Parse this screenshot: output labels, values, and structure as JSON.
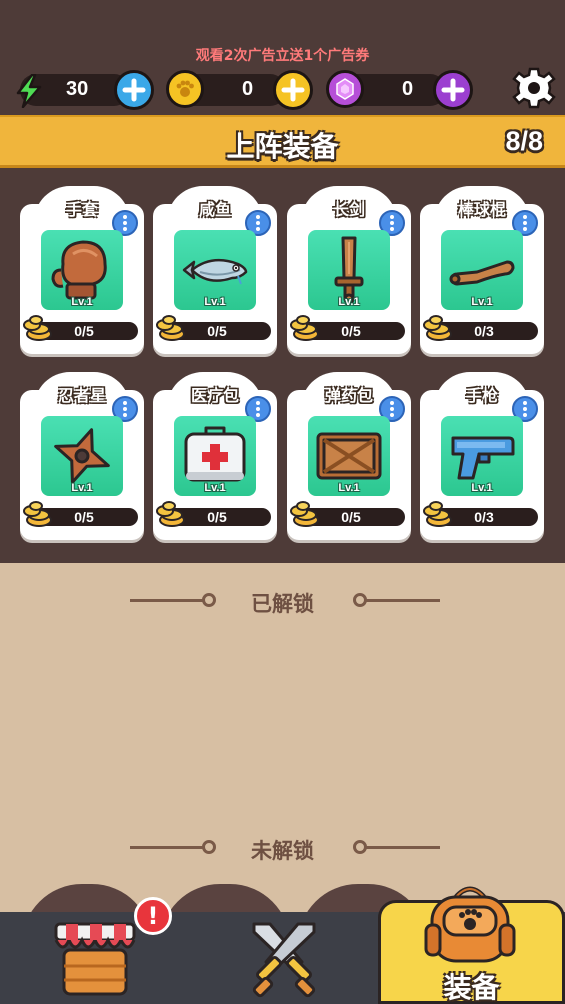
{
  "promo_text": "观看2次广告立送1个广告券",
  "currencies": [
    {
      "name": "energy",
      "icon": "lightning-icon",
      "value": "30",
      "color": "#3ed04a",
      "plus_color": "#3aa8e8"
    },
    {
      "name": "coin",
      "icon": "paw-coin-icon",
      "value": "0",
      "color": "#f5c324",
      "plus_color": "#f5c324"
    },
    {
      "name": "gem",
      "icon": "gem-icon",
      "value": "0",
      "color": "#b64fd8",
      "plus_color": "#9b3fd0"
    }
  ],
  "banner": {
    "title": "上阵装备",
    "count": "8/8"
  },
  "equipment": [
    {
      "name": "手套",
      "icon": "boxing-glove-icon",
      "level": "Lv.1",
      "progress": "0/5"
    },
    {
      "name": "咸鱼",
      "icon": "fish-icon",
      "level": "Lv.1",
      "progress": "0/5"
    },
    {
      "name": "长剑",
      "icon": "wooden-sword-icon",
      "level": "Lv.1",
      "progress": "0/5"
    },
    {
      "name": "棒球棍",
      "icon": "baseball-bat-icon",
      "level": "Lv.1",
      "progress": "0/3"
    },
    {
      "name": "忍者星",
      "icon": "shuriken-icon",
      "level": "Lv.1",
      "progress": "0/5"
    },
    {
      "name": "医疗包",
      "icon": "medkit-icon",
      "level": "Lv.1",
      "progress": "0/5"
    },
    {
      "name": "弹药包",
      "icon": "ammo-crate-icon",
      "level": "Lv.1",
      "progress": "0/5"
    },
    {
      "name": "手枪",
      "icon": "pistol-icon",
      "level": "Lv.1",
      "progress": "0/3"
    }
  ],
  "sections": {
    "unlocked": "已解锁",
    "locked": "未解锁"
  },
  "nav": {
    "shop_alert": "!",
    "equip_label": "装备"
  }
}
